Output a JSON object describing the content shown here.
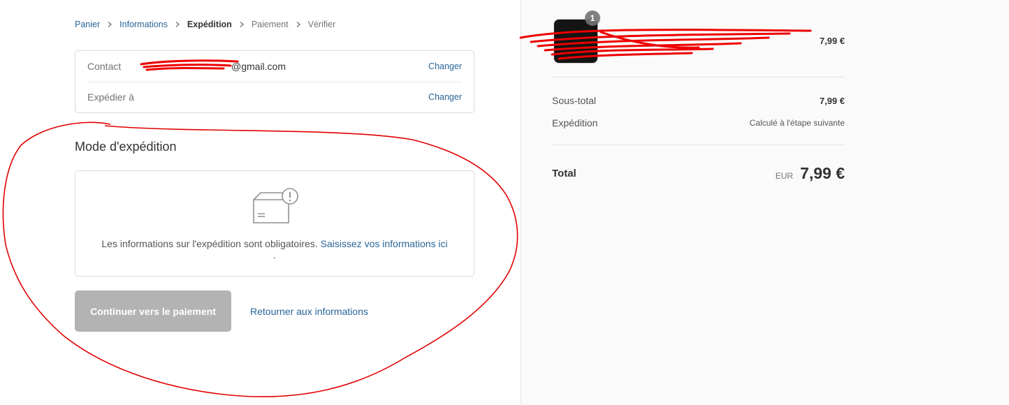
{
  "breadcrumb": {
    "items": [
      {
        "label": "Panier",
        "state": "link"
      },
      {
        "label": "Informations",
        "state": "link"
      },
      {
        "label": "Expédition",
        "state": "current"
      },
      {
        "label": "Paiement",
        "state": "upcoming"
      },
      {
        "label": "Vérifier",
        "state": "upcoming"
      }
    ]
  },
  "review": {
    "contact_label": "Contact",
    "contact_value": "@gmail.com",
    "ship_to_label": "Expédier à",
    "ship_to_value": "",
    "change_label": "Changer"
  },
  "shipping": {
    "title": "Mode d'expédition",
    "icon": "package-warning-icon",
    "message": "Les informations sur l'expédition sont obligatoires.",
    "link": "Saisissez vos informations ici",
    "trailing": "."
  },
  "actions": {
    "continue_label": "Continuer vers le paiement",
    "return_label": "Retourner aux informations"
  },
  "summary": {
    "product": {
      "quantity": "1",
      "name": "",
      "variant": "",
      "price": "7,99 €"
    },
    "subtotal_label": "Sous-total",
    "subtotal_value": "7,99 €",
    "shipping_label": "Expédition",
    "shipping_value": "Calculé à l'étape suivante",
    "total_label": "Total",
    "currency": "EUR",
    "total_value": "7,99 €"
  },
  "colors": {
    "link": "#2a6496",
    "button_disabled": "#b3b3b3",
    "annotation": "#e00000",
    "sidebar_bg": "#fafafa"
  }
}
